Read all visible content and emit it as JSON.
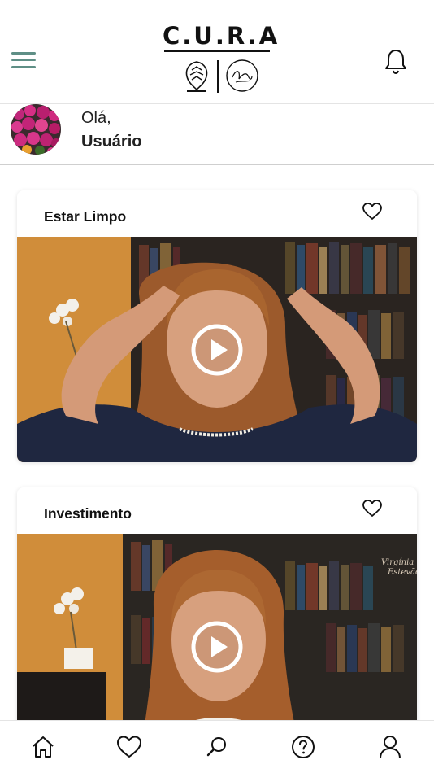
{
  "app": {
    "logo_text": "C.U.R.A",
    "colors": {
      "accent": "#5f8f86",
      "text": "#111111",
      "divider": "#cfcfcf"
    }
  },
  "header": {
    "menu_icon": "hamburger-menu-icon",
    "notifications_icon": "bell-icon"
  },
  "greeting": {
    "hello": "Olá,",
    "name": "Usuário"
  },
  "videos": [
    {
      "title": "Estar Limpo",
      "favorite_icon": "heart-outline-icon",
      "play_icon": "play-icon"
    },
    {
      "title": "Investimento",
      "favorite_icon": "heart-outline-icon",
      "play_icon": "play-icon"
    }
  ],
  "tabbar": {
    "items": [
      {
        "icon": "home-icon"
      },
      {
        "icon": "heart-icon"
      },
      {
        "icon": "search-icon"
      },
      {
        "icon": "help-icon"
      },
      {
        "icon": "profile-icon"
      }
    ]
  }
}
